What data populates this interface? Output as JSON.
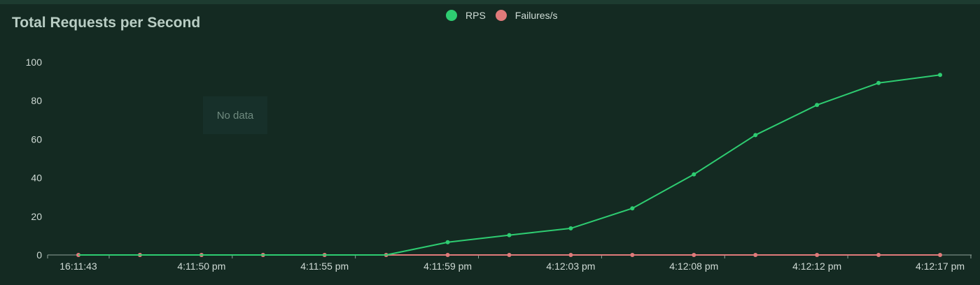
{
  "chart_data": {
    "type": "line",
    "title": "Total Requests per Second",
    "x": [
      "16:11:43",
      "",
      "4:11:50 pm",
      "",
      "4:11:55 pm",
      "",
      "4:11:59 pm",
      "",
      "4:12:03 pm",
      "",
      "4:12:08 pm",
      "",
      "4:12:12 pm",
      "",
      "4:12:17 pm"
    ],
    "xtick_labels": [
      "16:11:43",
      "4:11:50 pm",
      "4:11:55 pm",
      "4:11:59 pm",
      "4:12:03 pm",
      "4:12:08 pm",
      "4:12:12 pm",
      "4:12:17 pm"
    ],
    "xtick_indices": [
      0,
      2,
      4,
      6,
      8,
      10,
      12,
      14
    ],
    "series": [
      {
        "name": "RPS",
        "color": "#2ecc71",
        "values": [
          0,
          0,
          0,
          0,
          0,
          0,
          6.6,
          10.3,
          13.8,
          24.2,
          41.8,
          62.2,
          77.8,
          89.2,
          93.4
        ]
      },
      {
        "name": "Failures/s",
        "color": "#e07a7a",
        "values": [
          0,
          0,
          0,
          0,
          0,
          0,
          0,
          0,
          0,
          0,
          0,
          0,
          0,
          0,
          0
        ]
      }
    ],
    "ylim": [
      0,
      100
    ],
    "yticks": [
      0,
      20,
      40,
      60,
      80,
      100
    ],
    "legend_position": "top-center",
    "grid": false
  },
  "no_data_label": "No data"
}
